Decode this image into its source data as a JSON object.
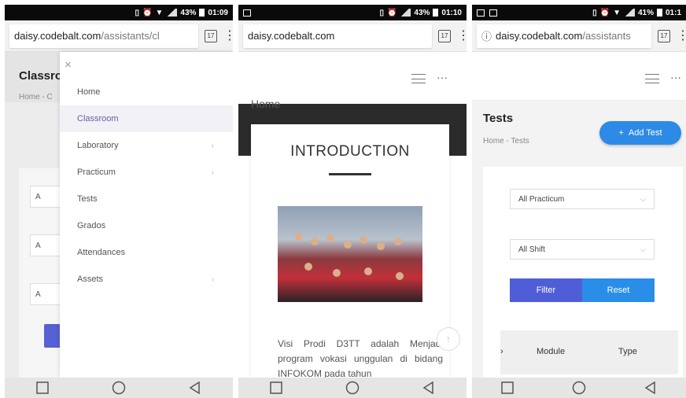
{
  "screens": [
    {
      "status": {
        "battery": "43%",
        "time": "01:09"
      },
      "url": {
        "host": "daisy.codebalt.com",
        "path": "/assistants/cl"
      },
      "tab_count": "17",
      "page": {
        "title": "Classro",
        "breadcrumb": "Home - C"
      },
      "fields": [
        "A",
        "A",
        "A"
      ],
      "drawer": {
        "close_glyph": "×",
        "items": [
          {
            "label": "Home",
            "has_children": false,
            "active": false
          },
          {
            "label": "Classroom",
            "has_children": false,
            "active": true
          },
          {
            "label": "Laboratory",
            "has_children": true,
            "active": false
          },
          {
            "label": "Practicum",
            "has_children": true,
            "active": false
          },
          {
            "label": "Tests",
            "has_children": false,
            "active": false
          },
          {
            "label": "Grados",
            "has_children": false,
            "active": false
          },
          {
            "label": "Attendances",
            "has_children": false,
            "active": false
          },
          {
            "label": "Assets",
            "has_children": true,
            "active": false
          }
        ]
      }
    },
    {
      "status": {
        "battery": "43%",
        "time": "01:10"
      },
      "url": {
        "host": "daisy.codebalt.com",
        "path": ""
      },
      "tab_count": "17",
      "ghost_heading": "Home",
      "card": {
        "heading": "INTRODUCTION",
        "text": "Visi Prodi D3TT adalah Menjadi program vokasi unggulan di bidang INFOKOM pada tahun"
      }
    },
    {
      "status": {
        "battery": "41%",
        "time": "01:1"
      },
      "url": {
        "host": "daisy.codebalt.com",
        "path": "/assistants"
      },
      "tab_count": "17",
      "page": {
        "title": "Tests",
        "breadcrumb": "Home - Tests"
      },
      "add_button": "Add Test",
      "filters": {
        "practicum": "All Practicum",
        "shift": "All Shift"
      },
      "buttons": {
        "filter": "Filter",
        "reset": "Reset"
      },
      "table_columns": [
        "›",
        "Module",
        "Type"
      ]
    }
  ],
  "colors": {
    "accent_indigo": "#4f5ed6",
    "accent_blue": "#2d8ae6",
    "active_menu_text": "#6c5ca8"
  }
}
